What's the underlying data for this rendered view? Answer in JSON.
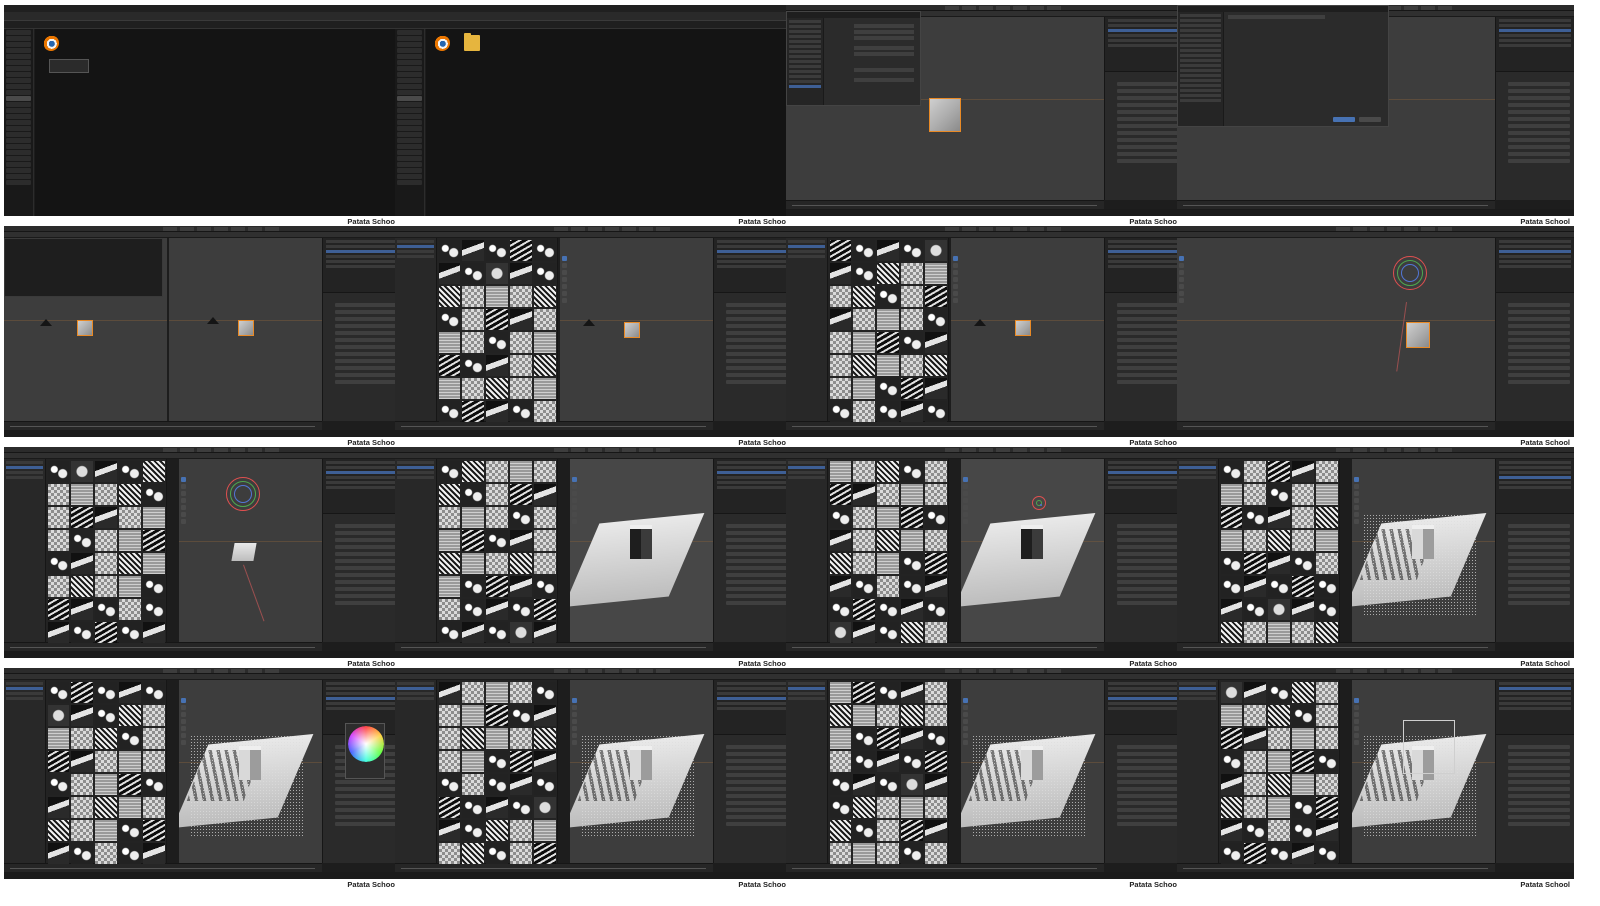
{
  "watermark": "Patata School",
  "colors": {
    "page_background": "#ffffff",
    "blender_ui": "#2b2b2b",
    "viewport": "#3d3d3d",
    "selection_accent": "#4772b3",
    "active_outline": "#e98a26",
    "folder": "#e6b53e"
  },
  "icons": [
    "blender-logo-icon",
    "folder-icon",
    "camera-icon",
    "cube-icon",
    "color-wheel-icon",
    "transform-gizmo-icon"
  ],
  "frames": [
    {
      "id": 1,
      "scene": "file-explorer"
    },
    {
      "id": 2,
      "scene": "file-explorer-new-folder"
    },
    {
      "id": 3,
      "scene": "preferences-dialog"
    },
    {
      "id": 4,
      "scene": "file-browser-dialog"
    },
    {
      "id": 5,
      "scene": "split-viewport"
    },
    {
      "id": 6,
      "scene": "texture-browser"
    },
    {
      "id": 7,
      "scene": "texture-browser-drag"
    },
    {
      "id": 8,
      "scene": "light-gizmo"
    },
    {
      "id": 9,
      "scene": "light-gizmo-plane"
    },
    {
      "id": 10,
      "scene": "gobo-shadow"
    },
    {
      "id": 11,
      "scene": "gobo-shadow-edit"
    },
    {
      "id": 12,
      "scene": "gobo-render"
    },
    {
      "id": 13,
      "scene": "color-picker"
    },
    {
      "id": 14,
      "scene": "gobo-render-2"
    },
    {
      "id": 15,
      "scene": "gobo-render-3"
    },
    {
      "id": 16,
      "scene": "wireframe-render"
    }
  ]
}
